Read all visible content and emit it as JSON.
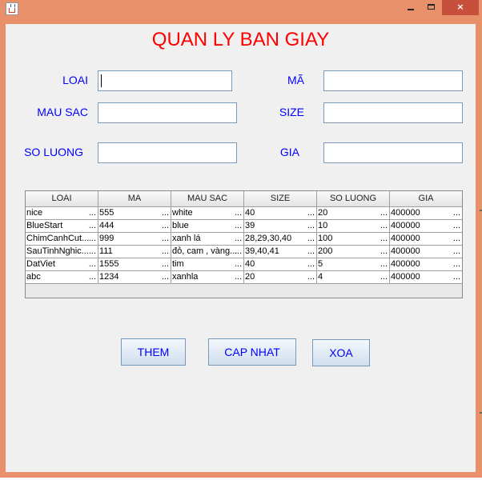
{
  "window": {
    "title": "",
    "controls": {
      "minimize": "",
      "maximize": "",
      "close": "×"
    }
  },
  "form": {
    "heading": "QUAN LY BAN GIAY",
    "labels": {
      "loai": "LOAI",
      "ma": "MÃ",
      "mau_sac": "MAU SAC",
      "size": "SIZE",
      "so_luong": "SO LUONG",
      "gia": "GIA"
    },
    "values": {
      "loai": "",
      "ma": "",
      "mau_sac": "",
      "size": "",
      "so_luong": "",
      "gia": ""
    }
  },
  "table": {
    "columns": [
      "LOAI",
      "MA",
      "MAU SAC",
      "SIZE",
      "SO LUONG",
      "GIA"
    ],
    "rows": [
      [
        "nice",
        "555",
        "white",
        "40",
        "20",
        "400000"
      ],
      [
        "BlueStart",
        "444",
        "blue",
        "39",
        "10",
        "400000"
      ],
      [
        "ChimCanhCut...",
        "999",
        "xanh lá",
        "28,29,30,40",
        "100",
        "400000"
      ],
      [
        "SauTinhNghic...",
        "111",
        "đỏ, cam , vàng...",
        "39,40,41",
        "200",
        "400000"
      ],
      [
        "DatViet",
        "1555",
        "tim",
        "40",
        "5",
        "400000"
      ],
      [
        "abc",
        "1234",
        "xanhla",
        "20",
        "4",
        "400000"
      ]
    ],
    "ellipsis": "..."
  },
  "buttons": {
    "them": "THEM",
    "cap_nhat": "CAP NHAT",
    "xoa": "XOA"
  }
}
